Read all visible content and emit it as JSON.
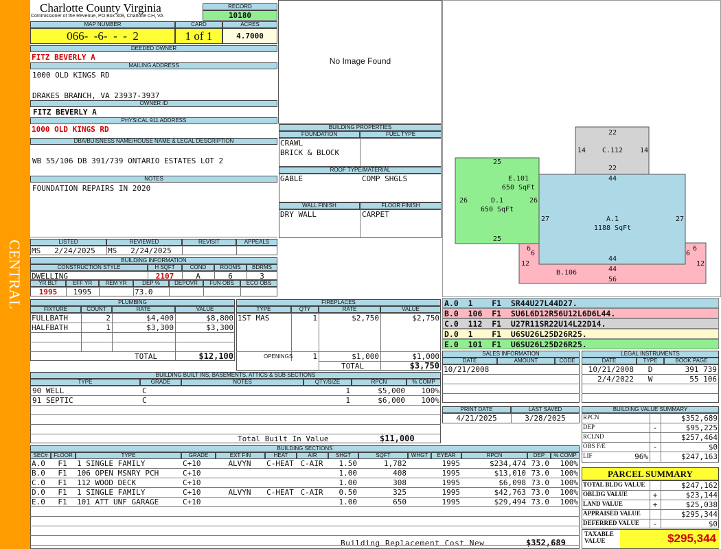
{
  "side_label": "CENTRAL",
  "county": {
    "name": "Charlotte County Virginia",
    "sub": "Commissioner of the Revenue, PO Box 308, Charlotte CH, VA"
  },
  "record": {
    "label": "RECORD",
    "value": "10180"
  },
  "map": {
    "label": "MAP NUMBER",
    "value": "066-  -6-  -  -  2",
    "card_label": "CARD",
    "card": "1 of 1",
    "acres_label": "ACRES",
    "acres": "4.7000"
  },
  "owner": {
    "label": "DEEDED OWNER",
    "value": "FITZ BEVERLY A"
  },
  "mailing": {
    "label": "MAILING ADDRESS",
    "line1": "1000 OLD KINGS RD",
    "line2": "DRAKES BRANCH, VA 23937-3937"
  },
  "owner_id": {
    "label": "OWNER ID",
    "value": "FITZ BEVERLY A"
  },
  "phys": {
    "label": "PHYSICAL 911 ADDRESS",
    "value": "1000 OLD KINGS RD"
  },
  "legal_desc": {
    "label": "DBA/BUISNESS NAME/HOUSE NAME & LEGAL DESCRIPTION",
    "value": "WB 55/106 DB 391/739 ONTARIO ESTATES LOT 2"
  },
  "notes": {
    "label": "NOTES",
    "value": "FOUNDATION REPAIRS IN 2020"
  },
  "image_placeholder": "No Image Found",
  "bldg_props": {
    "label": "BUILDING PROPERTIES",
    "foundation_label": "FOUNDATION",
    "fuel_label": "FUEL TYPE",
    "foundation1": "CRAWL",
    "foundation2": "BRICK & BLOCK",
    "roof_label": "ROOF TYPE/MATERIAL",
    "roof_type": "GABLE",
    "roof_mat": "COMP SHGLS",
    "wall_label": "WALL FINISH",
    "floor_label": "FLOOR FINISH",
    "wall": "DRY WALL",
    "floor": "CARPET"
  },
  "listed": {
    "listed_label": "LISTED",
    "reviewed_label": "REVIEWED",
    "revisit_label": "REVISIT",
    "appeals_label": "APPEALS",
    "listed": "MS   2/24/2025",
    "reviewed": "MS   2/24/2025"
  },
  "bldg_info": {
    "label": "BUILDING INFORMATION",
    "style_label": "CONSTRUCTION STYLE",
    "hsqft_label": "H SQFT",
    "cond_label": "COND",
    "rooms_label": "ROOMS",
    "bdrms_label": "BDRMS",
    "style": "DWELLING",
    "hsqft": "2107",
    "cond": "A",
    "rooms": "6",
    "bdrms": "3",
    "yrblt_label": "YR BLT",
    "effyr_label": "EFF YR",
    "remyr_label": "REM YR",
    "dep_label": "DEP %",
    "depovr_label": "DEPOVR",
    "funobs_label": "FUN OBS",
    "ecoobs_label": "ECO OBS",
    "yrblt": "1995",
    "effyr": "1995",
    "dep": "73.0"
  },
  "plumbing": {
    "label": "PLUMBING",
    "h_fixture": "FIXTURE",
    "h_count": "COUNT",
    "h_rate": "RATE",
    "h_value": "VALUE",
    "rows": [
      {
        "fixture": "FULLBATH",
        "count": "2",
        "rate": "$4,400",
        "value": "$8,800"
      },
      {
        "fixture": "HALFBATH",
        "count": "1",
        "rate": "$3,300",
        "value": "$3,300"
      }
    ],
    "total_label": "TOTAL",
    "total": "$12,100"
  },
  "fireplaces": {
    "label": "FIREPLACES",
    "h_type": "TYPE",
    "h_qty": "QTY",
    "h_rate": "RATE",
    "h_value": "VALUE",
    "rows": [
      {
        "type": "1ST MAS",
        "qty": "1",
        "rate": "$2,750",
        "value": "$2,750"
      }
    ],
    "openings_label": "OPENINGS",
    "openings_qty": "1",
    "openings_rate": "$1,000",
    "openings_value": "$1,000",
    "total_label": "TOTAL",
    "total": "$3,750"
  },
  "builtins": {
    "label": "BUILDING BUILT INS, BASEMENTS, ATTICS & SUB SECTIONS",
    "h_type": "TYPE",
    "h_grade": "GRADE",
    "h_notes": "NOTES",
    "h_qty": "QTY/SIZE",
    "h_rpcn": "RPCN",
    "h_comp": "% COMP",
    "rows": [
      {
        "type": "90 WELL",
        "grade": "C",
        "qty": "1",
        "rpcn": "$5,000",
        "comp": "100%"
      },
      {
        "type": "91 SEPTIC",
        "grade": "C",
        "qty": "1",
        "rpcn": "$6,000",
        "comp": "100%"
      }
    ],
    "total_label": "Total Built In Value",
    "total": "$11,000"
  },
  "sketch": {
    "areas": [
      {
        "name": "C.112",
        "sqft": ""
      },
      {
        "name": "E.101",
        "sqft": "650 SqFt"
      },
      {
        "name": "D.1",
        "sqft": "650 SqFt"
      },
      {
        "name": "A.1",
        "sqft": "1188 SqFt"
      },
      {
        "name": "B.106",
        "sqft": ""
      }
    ],
    "dims": [
      "22",
      "14",
      "14",
      "22",
      "44",
      "25",
      "26",
      "26",
      "27",
      "27",
      "25",
      "6",
      "6",
      "12",
      "44",
      "6",
      "6",
      "12",
      "44",
      "56"
    ],
    "colors": {
      "A": "#add8e6",
      "B": "#ffb6c1",
      "C": "#d3d3d3",
      "D": "#fffacd",
      "E": "#90ee90"
    }
  },
  "sketch_codes": [
    {
      "text": "A.0  1    F1  SR44U27L44D27.",
      "color": "#add8e6"
    },
    {
      "text": "B.0  106  F1  SU6L6D12R56U12L6D6L44.",
      "color": "#ffb6c1"
    },
    {
      "text": "C.0  112  F1  U27R11SR22U14L22D14.",
      "color": "#d3d3d3"
    },
    {
      "text": "D.0  1    F1  U6SU26L25D26R25.",
      "color": "#fffacd"
    },
    {
      "text": "E.0  101  F1  U6SU26L25D26R25.",
      "color": "#90ee90"
    }
  ],
  "sales": {
    "label": "SALES INFORMATION",
    "h_date": "DATE",
    "h_amount": "AMOUNT",
    "h_code": "CODE",
    "rows": [
      {
        "date": "10/21/2008"
      }
    ]
  },
  "legal_instr": {
    "label": "LEGAL INSTRUMENTS",
    "h_date": "DATE",
    "h_type": "TYPE",
    "h_book": "BOOK PAGE",
    "rows": [
      {
        "date": "10/21/2008",
        "type": "D",
        "book": "391 739"
      },
      {
        "date": "2/4/2022",
        "type": "W",
        "book": "55 106"
      }
    ]
  },
  "print": {
    "print_label": "PRINT DATE",
    "saved_label": "LAST SAVED",
    "print_date": "4/21/2025",
    "last_saved": "3/28/2025"
  },
  "bvs": {
    "label": "BUILDING VALUE SUMMARY",
    "rows": [
      {
        "label": "RPCN",
        "sign": "",
        "value": "$352,689"
      },
      {
        "label": "DEP",
        "sign": "-",
        "value": "$95,225"
      },
      {
        "label": "RCLND",
        "sign": "",
        "value": "$257,464"
      },
      {
        "label": "OBS F/E",
        "sign": "-",
        "value": "$0"
      },
      {
        "label": "LIF",
        "pct": "96%",
        "sign": "",
        "value": "$247,163"
      }
    ]
  },
  "parcel": {
    "label": "PARCEL SUMMARY",
    "rows": [
      {
        "label": "TOTAL BLDG VALUE",
        "sign": "",
        "value": "$247,162"
      },
      {
        "label": "OBLDG VALUE",
        "sign": "+",
        "value": "$23,144"
      },
      {
        "label": "LAND VALUE",
        "sign": "+",
        "value": "$25,038"
      },
      {
        "label": "APPRAISED VALUE",
        "sign": "",
        "value": "$295,344"
      },
      {
        "label": "DEFERRED VALUE",
        "sign": "-",
        "value": "$0"
      }
    ],
    "taxable_label": "TAXABLE VALUE",
    "taxable": "$295,344"
  },
  "sections": {
    "label": "BUILDING SECTIONS",
    "headers": {
      "sec": "SEC#",
      "floor": "FLOOR",
      "type": "TYPE",
      "grade": "GRADE",
      "extfin": "EXT FIN",
      "heat": "HEAT",
      "air": "AIR",
      "shgt": "SHGT",
      "sqft": "SQFT",
      "wght": "WHGT",
      "eyear": "EYEAR",
      "rpcn": "RPCN",
      "dep": "DEP",
      "comp": "% COMP"
    },
    "rows": [
      {
        "sec": "A.0",
        "floor": "F1",
        "type": "1 SINGLE FAMILY",
        "grade": "C+10",
        "extfin": "ALVYN",
        "heat": "C-HEAT",
        "air": "C-AIR",
        "shgt": "1.50",
        "sqft": "1,782",
        "eyear": "1995",
        "rpcn": "$234,474",
        "dep": "73.0",
        "comp": "100%"
      },
      {
        "sec": "B.0",
        "floor": "F1",
        "type": "106 OPEN MSNRY PCH",
        "grade": "C+10",
        "extfin": "",
        "heat": "",
        "air": "",
        "shgt": "1.00",
        "sqft": "408",
        "eyear": "1995",
        "rpcn": "$13,010",
        "dep": "73.0",
        "comp": "100%"
      },
      {
        "sec": "C.0",
        "floor": "F1",
        "type": "112 WOOD DECK",
        "grade": "C+10",
        "extfin": "",
        "heat": "",
        "air": "",
        "shgt": "1.00",
        "sqft": "308",
        "eyear": "1995",
        "rpcn": "$6,098",
        "dep": "73.0",
        "comp": "100%"
      },
      {
        "sec": "D.0",
        "floor": "F1",
        "type": "1 SINGLE FAMILY",
        "grade": "C+10",
        "extfin": "ALVYN",
        "heat": "C-HEAT",
        "air": "C-AIR",
        "shgt": "0.50",
        "sqft": "325",
        "eyear": "1995",
        "rpcn": "$42,763",
        "dep": "73.0",
        "comp": "100%"
      },
      {
        "sec": "E.0",
        "floor": "F1",
        "type": "101 ATT UNF GARAGE",
        "grade": "C+10",
        "extfin": "",
        "heat": "",
        "air": "",
        "shgt": "1.00",
        "sqft": "650",
        "eyear": "1995",
        "rpcn": "$29,494",
        "dep": "73.0",
        "comp": "100%"
      }
    ],
    "total_label": "Building Replacement Cost New",
    "total": "$352,689"
  }
}
